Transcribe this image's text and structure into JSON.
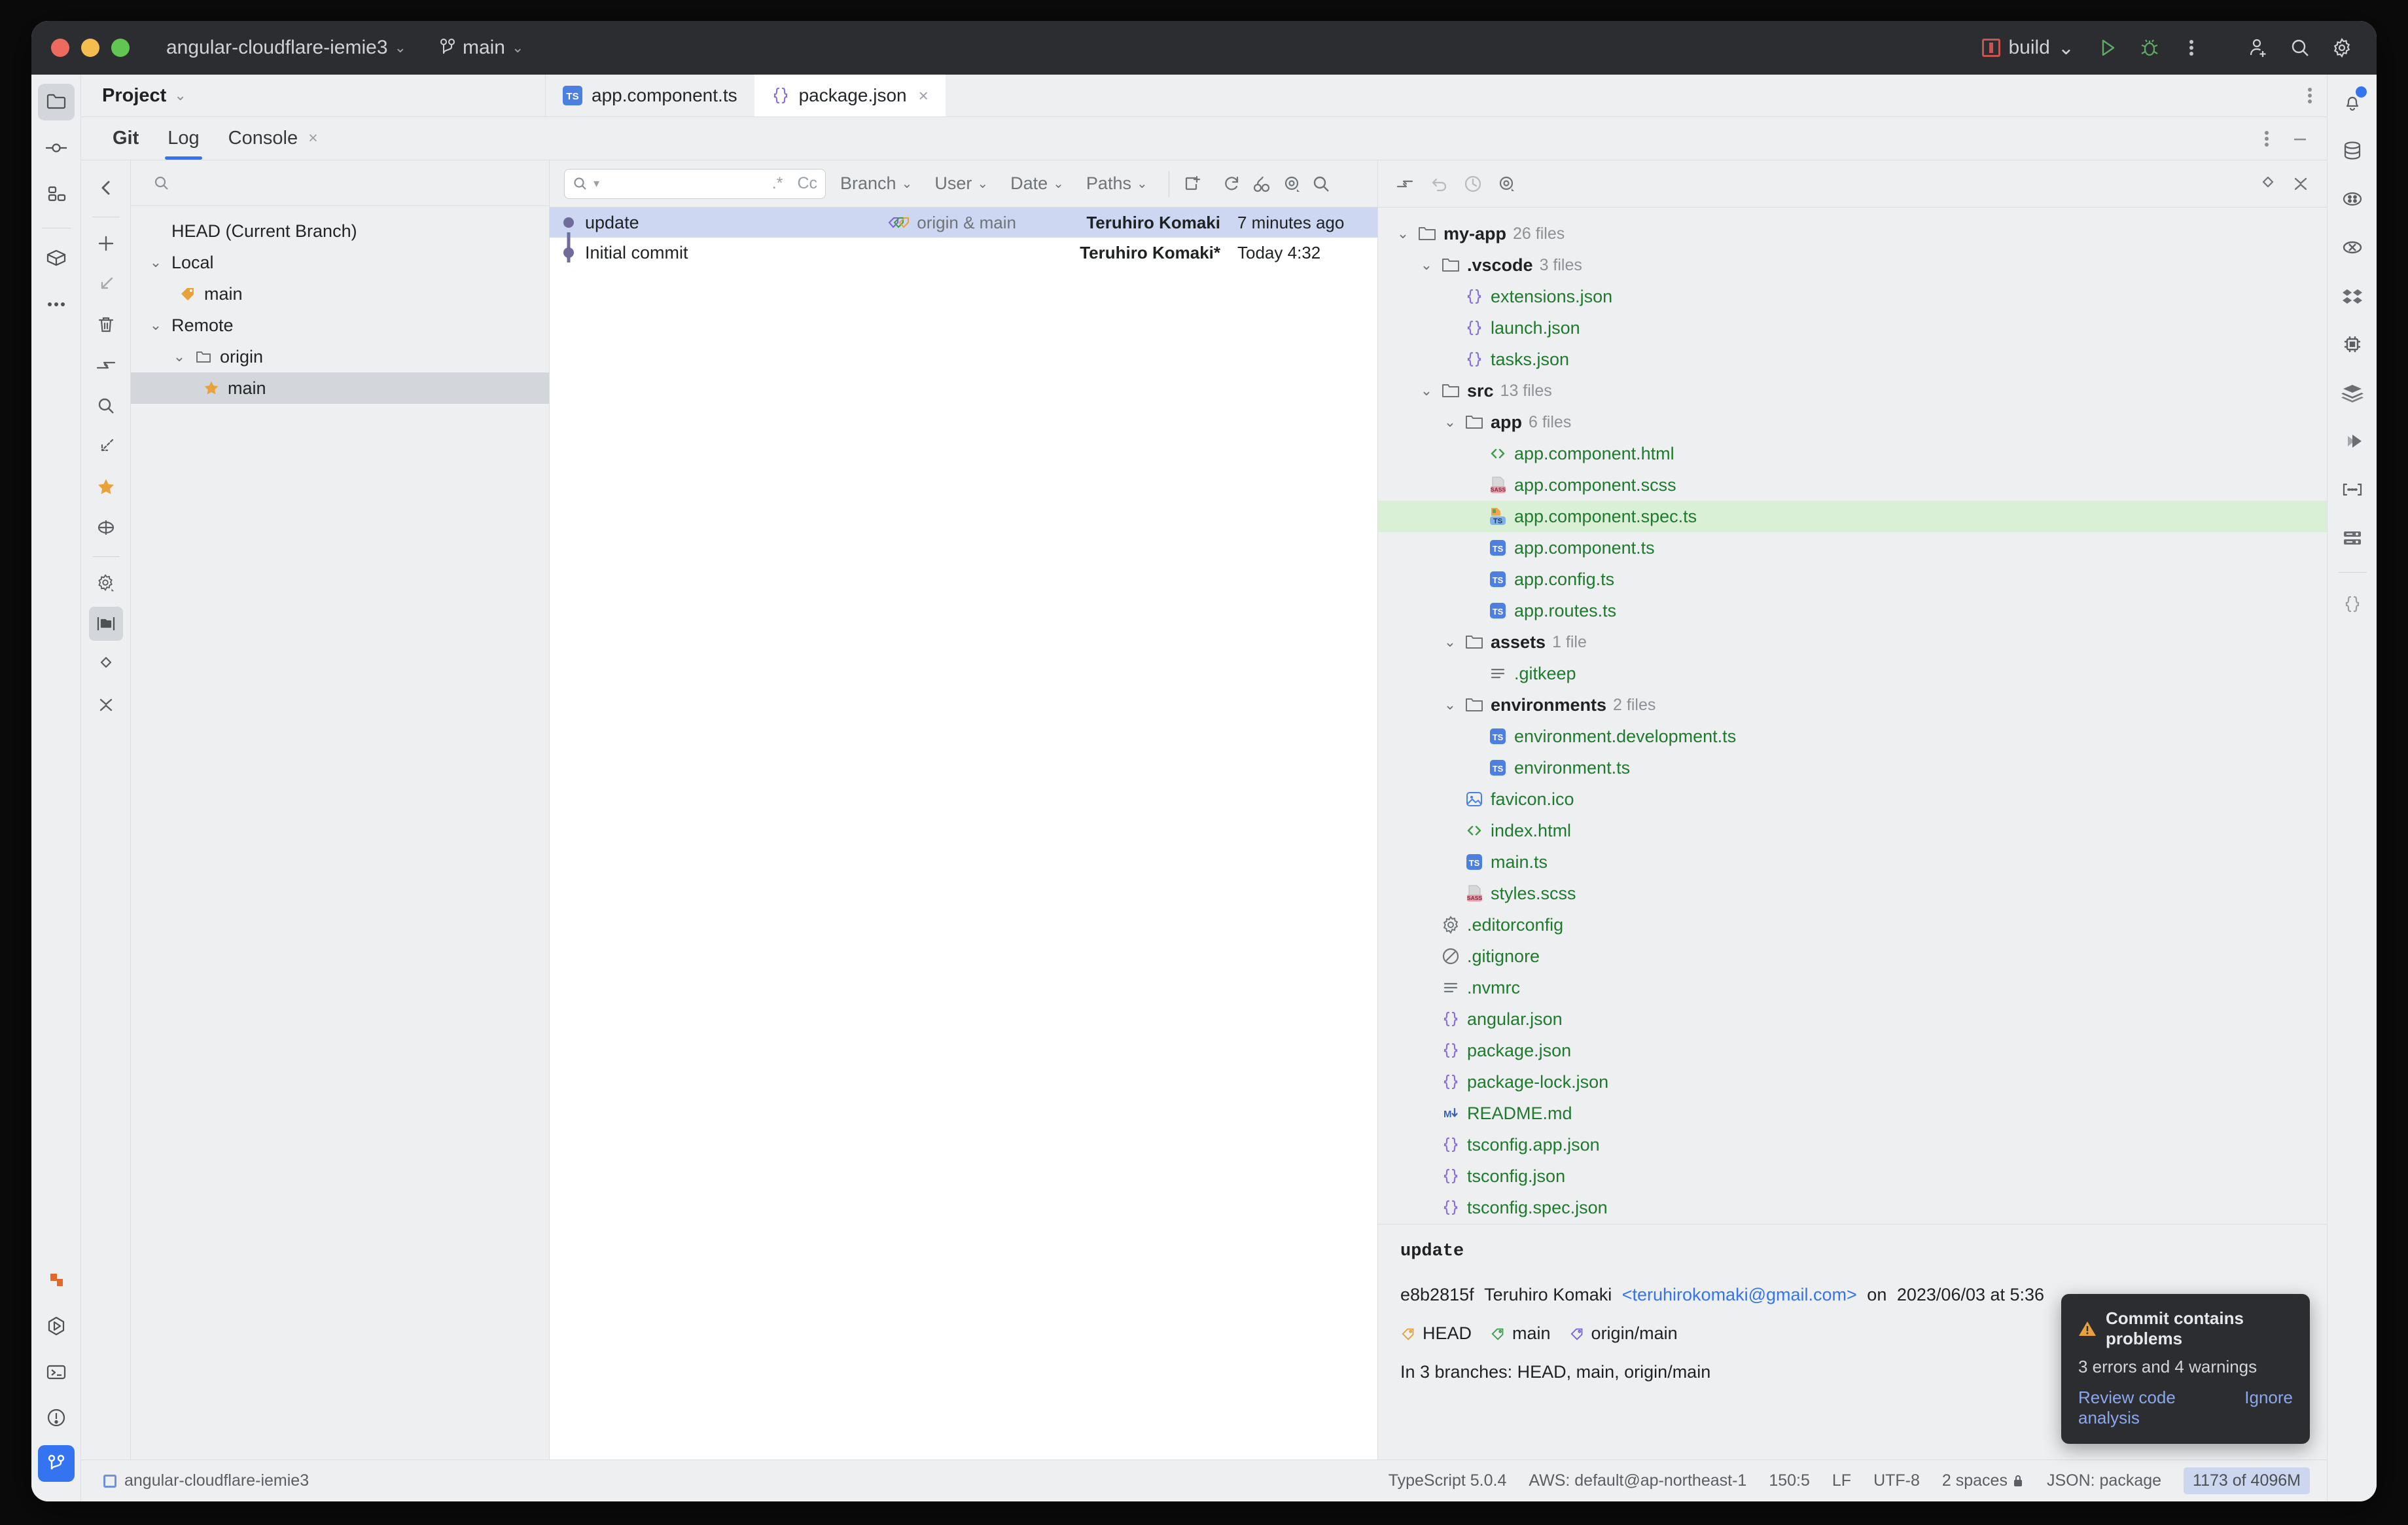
{
  "window": {
    "project_name": "angular-cloudflare-iemie3",
    "branch": "main",
    "run_config": "build"
  },
  "titlebar": {
    "project_caret": "⌄",
    "branch_caret": "⌄",
    "build_caret": "⌄",
    "icons": {
      "run": "run-icon",
      "debug": "debug-icon",
      "more": "more-options-icon",
      "account": "add-account-icon",
      "search": "search-icon",
      "settings": "settings-icon"
    }
  },
  "project_panel": {
    "label": "Project",
    "caret": "⌄"
  },
  "editor_tabs": [
    {
      "name": "app.component.ts",
      "icon": "TS",
      "icon_kind": "ts",
      "active": false,
      "closable": false
    },
    {
      "name": "package.json",
      "icon": "{}",
      "icon_kind": "json",
      "active": true,
      "closable": true,
      "close_glyph": "×"
    }
  ],
  "git_window": {
    "tabs": [
      {
        "label": "Git",
        "active": false,
        "bold": true
      },
      {
        "label": "Log",
        "active": true,
        "bold": false
      },
      {
        "label": "Console",
        "active": false,
        "bold": false,
        "closable": true,
        "close_glyph": "×"
      }
    ],
    "header_icons": {
      "more": "more-options-icon",
      "minimize": "minimize-icon"
    }
  },
  "branches_panel": {
    "search_placeholder": "",
    "items": [
      {
        "label": "HEAD (Current Branch)",
        "indent": 0,
        "icon": "none",
        "chevron": "",
        "selected": false
      },
      {
        "label": "Local",
        "indent": 0,
        "icon": "none",
        "chevron": "⌄",
        "selected": false
      },
      {
        "label": "main",
        "indent": 1,
        "icon": "tag-orange",
        "chevron": "",
        "selected": false
      },
      {
        "label": "Remote",
        "indent": 0,
        "icon": "none",
        "chevron": "⌄",
        "selected": false
      },
      {
        "label": "origin",
        "indent": 1,
        "icon": "folder",
        "chevron": "⌄",
        "selected": false
      },
      {
        "label": "main",
        "indent": 2,
        "icon": "star-orange",
        "chevron": "",
        "selected": true
      }
    ]
  },
  "commit_log": {
    "search_placeholder": "",
    "regex_label": ".*",
    "case_label": "Cc",
    "filters": [
      {
        "label": "Branch",
        "caret": "⌄"
      },
      {
        "label": "User",
        "caret": "⌄"
      },
      {
        "label": "Date",
        "caret": "⌄"
      },
      {
        "label": "Paths",
        "caret": "⌄"
      }
    ],
    "toolbar_icons": [
      "new-branch-icon",
      "refresh-icon",
      "cherry-pick-icon",
      "show-diff-icon",
      "search-icon"
    ],
    "commits": [
      {
        "subject": "update",
        "refs": "origin & main",
        "has_ref_tag": true,
        "author": "Teruhiro Komaki",
        "date": "7 minutes ago",
        "selected": true
      },
      {
        "subject": "Initial commit",
        "refs": "",
        "has_ref_tag": false,
        "author": "Teruhiro Komaki*",
        "date": "Today 4:32",
        "selected": false
      }
    ]
  },
  "details_panel": {
    "toolbar_icons": [
      "jump-to-source-icon",
      "undo-icon",
      "history-icon",
      "eye-icon"
    ],
    "right_icons": [
      "expand-collapse-icon",
      "collapse-all-icon"
    ],
    "file_tree": [
      {
        "name": "my-app",
        "count": "26 files",
        "indent": 0,
        "kind": "dir",
        "chevron": "⌄",
        "selected": false
      },
      {
        "name": ".vscode",
        "count": "3 files",
        "indent": 1,
        "kind": "dir",
        "chevron": "⌄",
        "selected": false
      },
      {
        "name": "extensions.json",
        "count": "",
        "indent": 2,
        "kind": "json",
        "chevron": "",
        "selected": false
      },
      {
        "name": "launch.json",
        "count": "",
        "indent": 2,
        "kind": "json",
        "chevron": "",
        "selected": false
      },
      {
        "name": "tasks.json",
        "count": "",
        "indent": 2,
        "kind": "json",
        "chevron": "",
        "selected": false
      },
      {
        "name": "src",
        "count": "13 files",
        "indent": 1,
        "kind": "dir",
        "chevron": "⌄",
        "selected": false
      },
      {
        "name": "app",
        "count": "6 files",
        "indent": 2,
        "kind": "dir",
        "chevron": "⌄",
        "selected": false
      },
      {
        "name": "app.component.html",
        "count": "",
        "indent": 3,
        "kind": "html",
        "chevron": "",
        "selected": false
      },
      {
        "name": "app.component.scss",
        "count": "",
        "indent": 3,
        "kind": "scss",
        "chevron": "",
        "selected": false
      },
      {
        "name": "app.component.spec.ts",
        "count": "",
        "indent": 3,
        "kind": "spec-ts",
        "chevron": "",
        "selected": true
      },
      {
        "name": "app.component.ts",
        "count": "",
        "indent": 3,
        "kind": "ts",
        "chevron": "",
        "selected": false
      },
      {
        "name": "app.config.ts",
        "count": "",
        "indent": 3,
        "kind": "ts",
        "chevron": "",
        "selected": false
      },
      {
        "name": "app.routes.ts",
        "count": "",
        "indent": 3,
        "kind": "ts",
        "chevron": "",
        "selected": false
      },
      {
        "name": "assets",
        "count": "1 file",
        "indent": 2,
        "kind": "dir",
        "chevron": "⌄",
        "selected": false
      },
      {
        "name": ".gitkeep",
        "count": "",
        "indent": 3,
        "kind": "text",
        "chevron": "",
        "selected": false
      },
      {
        "name": "environments",
        "count": "2 files",
        "indent": 2,
        "kind": "dir",
        "chevron": "⌄",
        "selected": false
      },
      {
        "name": "environment.development.ts",
        "count": "",
        "indent": 3,
        "kind": "ts",
        "chevron": "",
        "selected": false
      },
      {
        "name": "environment.ts",
        "count": "",
        "indent": 3,
        "kind": "ts",
        "chevron": "",
        "selected": false
      },
      {
        "name": "favicon.ico",
        "count": "",
        "indent": 2,
        "kind": "image",
        "chevron": "",
        "selected": false
      },
      {
        "name": "index.html",
        "count": "",
        "indent": 2,
        "kind": "html",
        "chevron": "",
        "selected": false
      },
      {
        "name": "main.ts",
        "count": "",
        "indent": 2,
        "kind": "ts",
        "chevron": "",
        "selected": false
      },
      {
        "name": "styles.scss",
        "count": "",
        "indent": 2,
        "kind": "scss",
        "chevron": "",
        "selected": false
      },
      {
        "name": ".editorconfig",
        "count": "",
        "indent": 1,
        "kind": "config",
        "chevron": "",
        "selected": false
      },
      {
        "name": ".gitignore",
        "count": "",
        "indent": 1,
        "kind": "ignore",
        "chevron": "",
        "selected": false
      },
      {
        "name": ".nvmrc",
        "count": "",
        "indent": 1,
        "kind": "text",
        "chevron": "",
        "selected": false
      },
      {
        "name": "angular.json",
        "count": "",
        "indent": 1,
        "kind": "json",
        "chevron": "",
        "selected": false
      },
      {
        "name": "package.json",
        "count": "",
        "indent": 1,
        "kind": "json",
        "chevron": "",
        "selected": false
      },
      {
        "name": "package-lock.json",
        "count": "",
        "indent": 1,
        "kind": "json",
        "chevron": "",
        "selected": false
      },
      {
        "name": "README.md",
        "count": "",
        "indent": 1,
        "kind": "markdown",
        "chevron": "",
        "selected": false
      },
      {
        "name": "tsconfig.app.json",
        "count": "",
        "indent": 1,
        "kind": "json",
        "chevron": "",
        "selected": false
      },
      {
        "name": "tsconfig.json",
        "count": "",
        "indent": 1,
        "kind": "json",
        "chevron": "",
        "selected": false
      },
      {
        "name": "tsconfig.spec.json",
        "count": "",
        "indent": 1,
        "kind": "json",
        "chevron": "",
        "selected": false
      }
    ]
  },
  "commit_details": {
    "subject": "update",
    "hash": "e8b2815f",
    "author": "Teruhiro Komaki",
    "email": "<teruhirokomaki@gmail.com>",
    "date_prefix": "on",
    "date": "2023/06/03 at 5:36",
    "refs": [
      {
        "label": "HEAD",
        "color": "#e3a13a"
      },
      {
        "label": "main",
        "color": "#3f9b46"
      },
      {
        "label": "origin/main",
        "color": "#7a62d6"
      }
    ],
    "branches_line": "In 3 branches: HEAD, main, origin/main"
  },
  "notification": {
    "title": "Commit contains problems",
    "subtitle": "3 errors and 4 warnings",
    "actions": [
      {
        "label": "Review code analysis"
      },
      {
        "label": "Ignore"
      }
    ],
    "warning_color": "#e9a13b"
  },
  "statusbar": {
    "left_label": "angular-cloudflare-iemie3",
    "items": [
      "TypeScript 5.0.4",
      "AWS: default@ap-northeast-1",
      "150:5",
      "LF",
      "UTF-8",
      "2 spaces",
      "JSON: package"
    ],
    "memory": "1173 of 4096M"
  },
  "left_rail": {
    "items": [
      {
        "name": "project-icon",
        "active": true
      },
      {
        "name": "commit-icon",
        "active": false
      },
      {
        "name": "structure-icon",
        "active": false
      },
      {
        "name": "services-icon",
        "active": false
      },
      {
        "name": "more-tool-windows-icon",
        "active": false
      }
    ],
    "bottom_items": [
      {
        "name": "angular-icon",
        "active": false
      },
      {
        "name": "run-anything-icon",
        "active": false
      },
      {
        "name": "terminal-icon",
        "active": false
      },
      {
        "name": "problems-icon",
        "active": false
      },
      {
        "name": "git-icon",
        "active": true
      }
    ]
  },
  "git_toolbar": {
    "items": [
      "back-icon",
      "add-icon",
      "checkout-icon",
      "delete-icon",
      "merge-icon",
      "search-icon",
      "rebase-icon",
      "favorite-star-icon",
      "target-icon",
      "settings-icon",
      "show-folders-icon",
      "expand-icon",
      "collapse-icon"
    ]
  },
  "right_rail": {
    "items": [
      {
        "name": "notifications-icon",
        "badge": true
      },
      {
        "name": "database-icon",
        "badge": false
      },
      {
        "name": "ai-assistant-icon",
        "badge": false
      },
      {
        "name": "coverage-icon",
        "badge": false
      },
      {
        "name": "dropbox-icon",
        "badge": false
      },
      {
        "name": "device-icon",
        "badge": false
      },
      {
        "name": "layers-icon",
        "badge": false
      },
      {
        "name": "send-request-icon",
        "badge": false
      },
      {
        "name": "secrets-icon",
        "badge": false
      },
      {
        "name": "server-icon",
        "badge": false
      },
      {
        "name": "json-icon",
        "badge": false
      }
    ]
  }
}
